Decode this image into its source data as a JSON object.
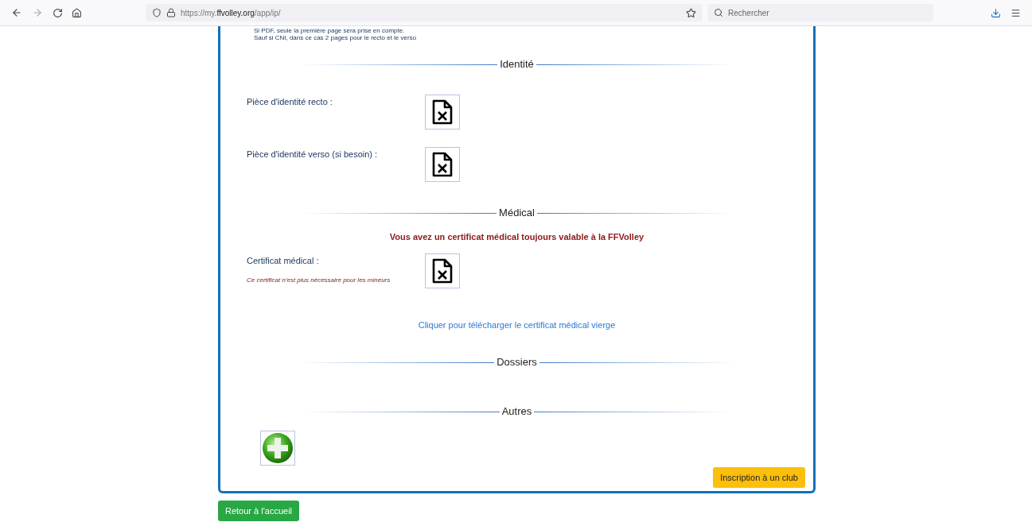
{
  "browser": {
    "url": {
      "prefix": "https://my.",
      "domain": "ffvolley.org",
      "path": "/app/ip/"
    },
    "search": {
      "placeholder": "Rechercher"
    }
  },
  "notes": [
    "Si PDF, seule la première page sera prise en compte.",
    "Sauf si CNI, dans ce cas 2 pages pour le recto et le verso"
  ],
  "sections": [
    {
      "title": "Identité",
      "rows": [
        {
          "kind": "file",
          "label": "Pièce d'identité recto :"
        },
        {
          "kind": "file",
          "label": "Pièce d'identité verso (si besoin) :"
        }
      ]
    },
    {
      "title": "Médical",
      "rows": [
        {
          "kind": "notice",
          "text": "Vous avez un certificat médical toujours valable à la FFVolley"
        },
        {
          "kind": "file",
          "label": "Certificat médical :",
          "note": "Ce certificat n'est plus nécessaire pour les mineurs"
        },
        {
          "kind": "link",
          "text": "Cliquer pour télécharger le certificat médical vierge"
        }
      ]
    },
    {
      "title": "Dossiers"
    },
    {
      "title": "Autres",
      "rows": [
        {
          "kind": "add"
        }
      ]
    }
  ],
  "club_button": "Inscription à un club",
  "home_button": "Retour à l'accueil"
}
